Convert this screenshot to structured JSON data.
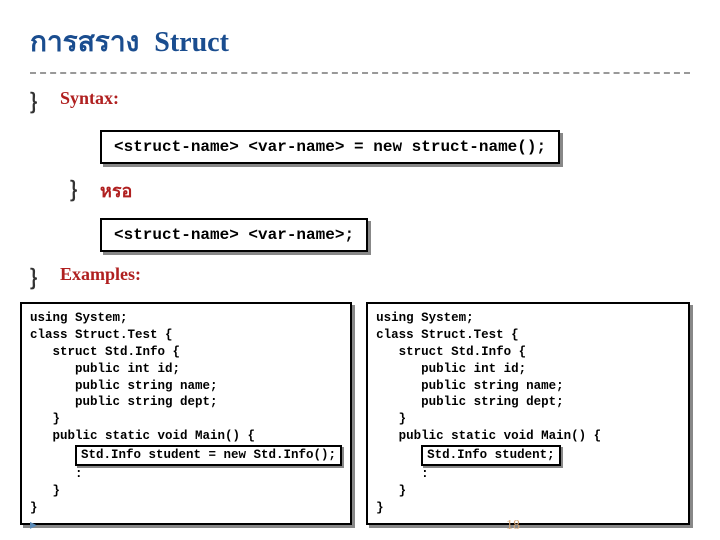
{
  "title": {
    "thai": "การสราง",
    "en": "Struct"
  },
  "labels": {
    "syntax": "Syntax:",
    "or": "หรอ",
    "examples": "Examples:"
  },
  "syntax1": "<struct-name> <var-name> = new struct-name();",
  "syntax2": "<struct-name> <var-name>;",
  "code_left": {
    "l1": "using System;",
    "l2": "class Struct.Test {",
    "l3": "   struct Std.Info {",
    "l4": "      public int id;",
    "l5": "      public string name;",
    "l6": "      public string dept;",
    "l7": "   }",
    "l8": "   public static void Main() {",
    "hl": "Std.Info student = new Std.Info();",
    "l10": "      :",
    "l11": "   }",
    "l12": "}"
  },
  "code_right": {
    "l1": "using System;",
    "l2": "class Struct.Test {",
    "l3": "   struct Std.Info {",
    "l4": "      public int id;",
    "l5": "      public string name;",
    "l6": "      public string dept;",
    "l7": "   }",
    "l8": "   public static void Main() {",
    "hl": "Std.Info student;",
    "l10": "      :",
    "l11": "   }",
    "l12": "}"
  },
  "page_number": "18",
  "footer_mark": "▸"
}
